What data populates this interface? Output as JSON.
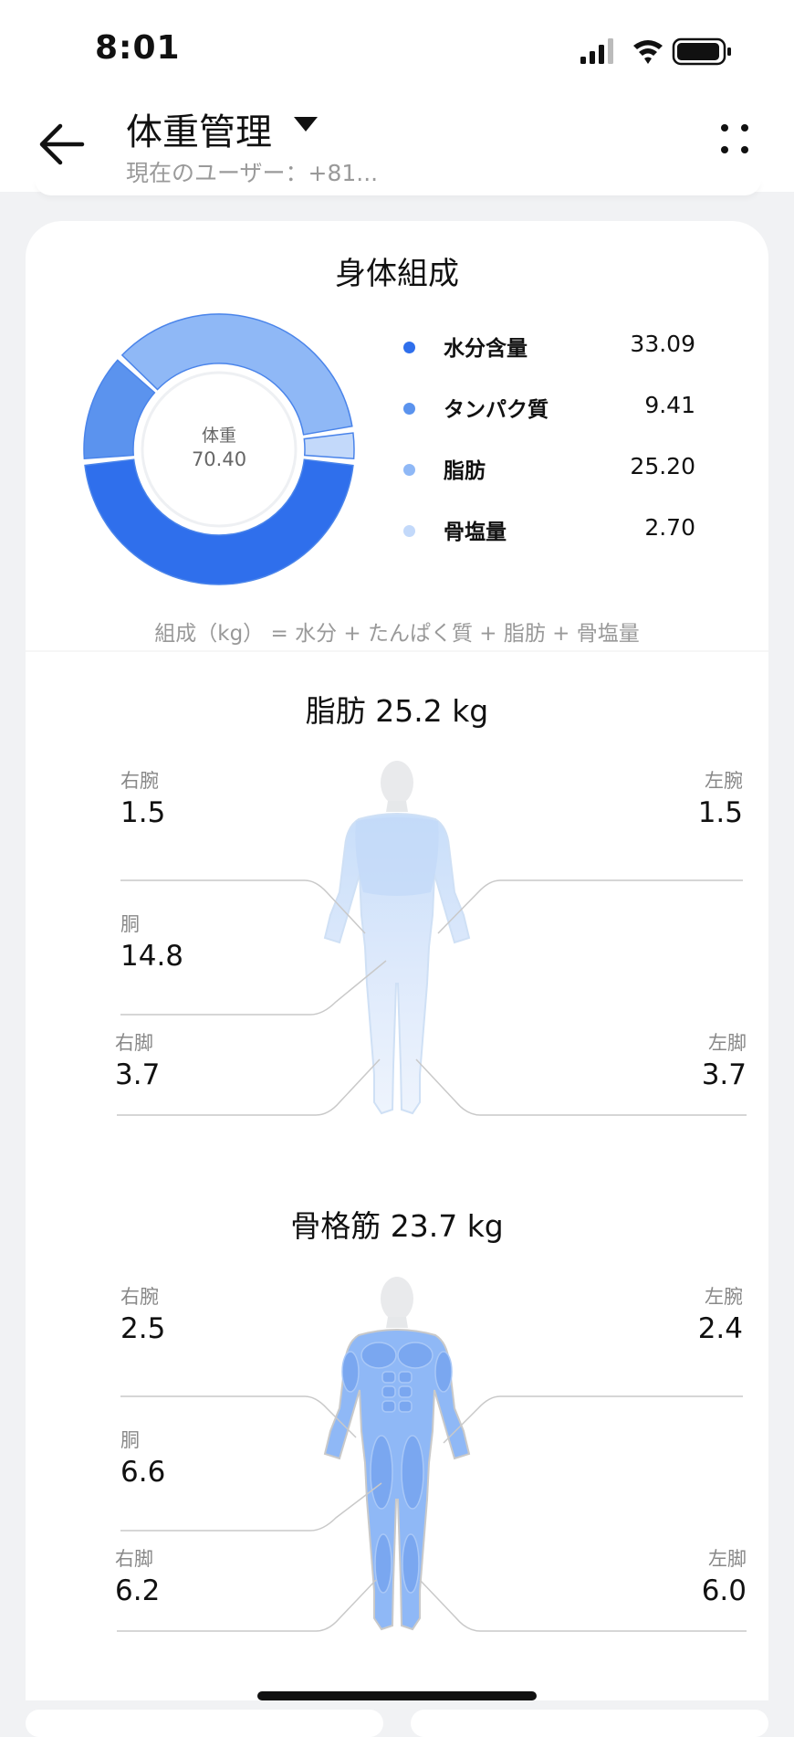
{
  "status": {
    "time": "8:01"
  },
  "header": {
    "title": "体重管理",
    "subtitle": "現在のユーザー：+81..."
  },
  "composition": {
    "title": "身体組成",
    "center_label": "体重",
    "center_value": "70.40",
    "legend": [
      {
        "name": "水分含量",
        "value": "33.09",
        "color": "#2f6fec"
      },
      {
        "name": "タンパク質",
        "value": "9.41",
        "color": "#5b93ee"
      },
      {
        "name": "脂肪",
        "value": "25.20",
        "color": "#8fb8f6"
      },
      {
        "name": "骨塩量",
        "value": "2.70",
        "color": "#c3d9fa"
      }
    ],
    "formula": "組成（kg） = 水分 + たんぱく質 + 脂肪 + 骨塩量"
  },
  "chart_data": {
    "type": "pie",
    "categories": [
      "水分含量",
      "タンパク質",
      "脂肪",
      "骨塩量"
    ],
    "values": [
      33.09,
      9.41,
      25.2,
      2.7
    ],
    "colors": [
      "#2f6fec",
      "#5b93ee",
      "#8fb8f6",
      "#c3d9fa"
    ]
  },
  "fat": {
    "title": "脂肪 25.2 kg",
    "right_arm_label": "右腕",
    "right_arm_value": "1.5",
    "left_arm_label": "左腕",
    "left_arm_value": "1.5",
    "torso_label": "胴",
    "torso_value": "14.8",
    "right_leg_label": "右脚",
    "right_leg_value": "3.7",
    "left_leg_label": "左脚",
    "left_leg_value": "3.7"
  },
  "muscle": {
    "title": "骨格筋 23.7 kg",
    "right_arm_label": "右腕",
    "right_arm_value": "2.5",
    "left_arm_label": "左腕",
    "left_arm_value": "2.4",
    "torso_label": "胴",
    "torso_value": "6.6",
    "right_leg_label": "右脚",
    "right_leg_value": "6.2",
    "left_leg_label": "左脚",
    "left_leg_value": "6.0"
  }
}
